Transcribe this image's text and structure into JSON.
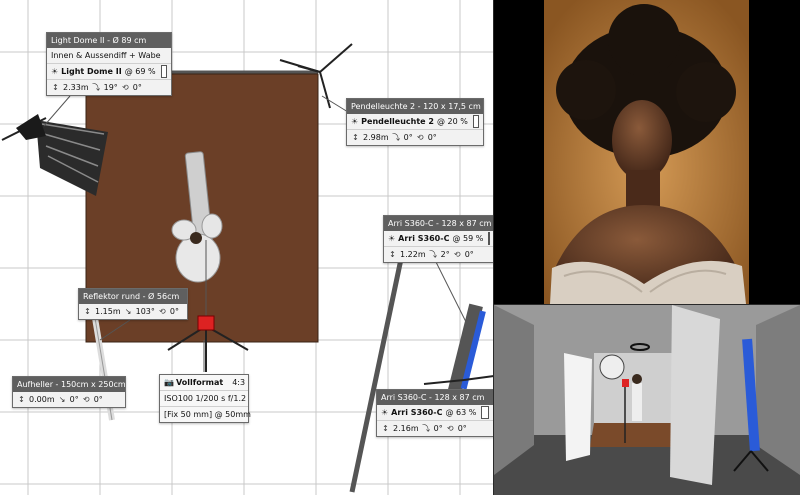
{
  "lights": [
    {
      "title": "Light Dome II - Ø 89 cm",
      "modifier": "Innen & Aussendiff + Wabe",
      "name": "Light Dome II",
      "power": "@ 69 %",
      "height": "2.33m",
      "tilt": "19°",
      "rotation": "0°"
    },
    {
      "title": "Pendelleuchte 2 - 120 x 17,5 cm",
      "name": "Pendelleuchte 2",
      "power": "@ 20 %",
      "height": "2.98m",
      "tilt": "0°",
      "rotation": "0°"
    },
    {
      "title": "Arri S360-C - 128 x 87 cm",
      "name": "Arri S360-C",
      "power": "@ 59 %",
      "height": "1.22m",
      "tilt": "2°",
      "rotation": "0°"
    },
    {
      "title": "Arri S360-C - 128 x 87 cm",
      "name": "Arri S360-C",
      "power": "@ 63 %",
      "height": "2.16m",
      "tilt": "0°",
      "rotation": "0°"
    }
  ],
  "reflectors": [
    {
      "title": "Reflektor rund - Ø 56cm",
      "height": "1.15m",
      "tilt": "103°",
      "rotation": "0°"
    },
    {
      "title": "Aufheller - 150cm x 250cm",
      "height": "0.00m",
      "tilt": "0°",
      "rotation": "0°"
    }
  ],
  "camera": {
    "format": "Vollformat",
    "ratio": "4:3",
    "settings": "ISO100  1/200 s  f/1.2",
    "lens": "[Fix 50 mm] @ 50mm"
  },
  "colors": {
    "backdrop": "#6b3f27",
    "panel_header": "#5f5f5f",
    "grid": "#c8c8c8",
    "photo_bg": "#b77a38",
    "floor": "#4a4a4a"
  },
  "icons": {
    "light": "sun-icon",
    "height": "height-arrows-icon",
    "tilt": "tilt-icon",
    "rotation": "rotation-icon",
    "camera": "camera-icon"
  }
}
